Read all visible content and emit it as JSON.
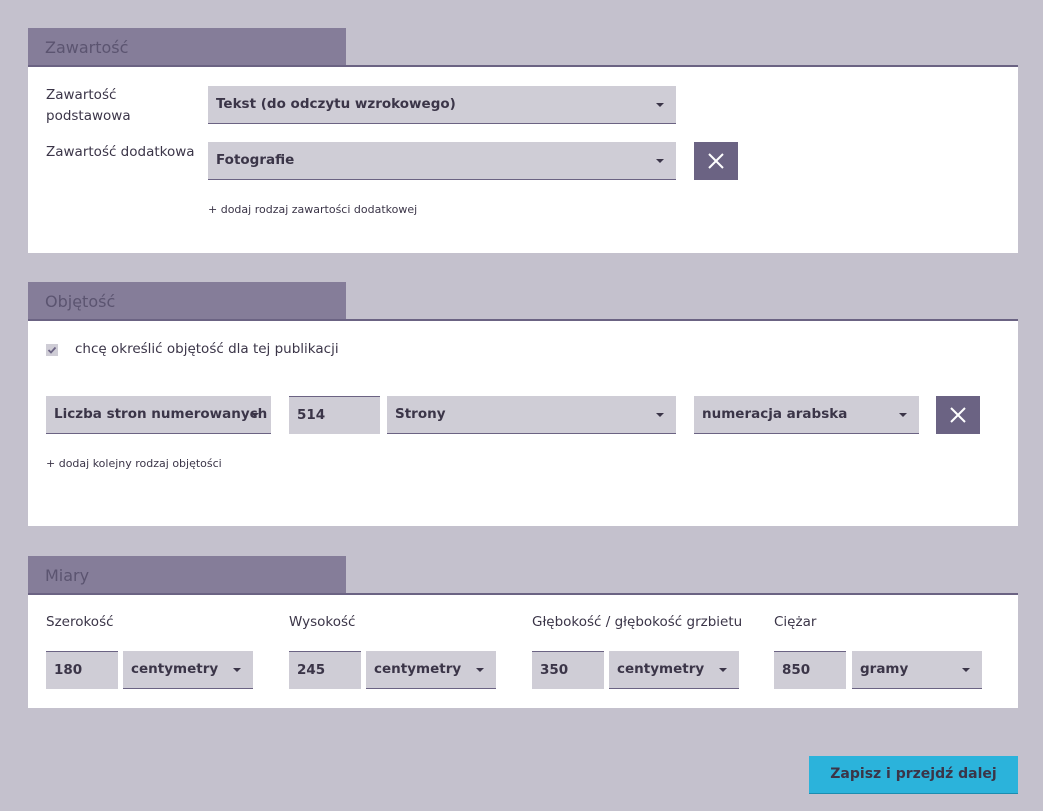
{
  "content": {
    "title": "Zawartość",
    "primary_label": "Zawartość podstawowa",
    "primary_value": "Tekst (do odczytu wzrokowego)",
    "secondary_label": "Zawartość dodatkowa",
    "secondary_value": "Fotografie",
    "add_link": "+ dodaj rodzaj zawartości dodatkowej"
  },
  "volume": {
    "title": "Objętość",
    "checkbox_label": "chcę określić objętość dla tej publikacji",
    "checkbox_checked": true,
    "type_value": "Liczba stron numerowanych ł",
    "number_value": "514",
    "unit_value": "Strony",
    "numbering_value": "numeracja arabska",
    "add_link": "+ dodaj kolejny rodzaj objętości"
  },
  "measures": {
    "title": "Miary",
    "width": {
      "label": "Szerokość",
      "value": "180",
      "unit": "centymetry"
    },
    "height": {
      "label": "Wysokość",
      "value": "245",
      "unit": "centymetry"
    },
    "depth": {
      "label": "Głębokość / głębokość grzbietu",
      "value": "350",
      "unit": "centymetry"
    },
    "weight": {
      "label": "Ciężar",
      "value": "850",
      "unit": "gramy"
    }
  },
  "save_label": "Zapisz i przejdź dalej",
  "colors": {
    "accent": "#2bb3db",
    "tab": "#857d99",
    "remove_button": "#6b6383",
    "background": "#c4c1cd"
  },
  "icons": [
    "close-icon",
    "chevron-down-icon",
    "check-icon"
  ]
}
